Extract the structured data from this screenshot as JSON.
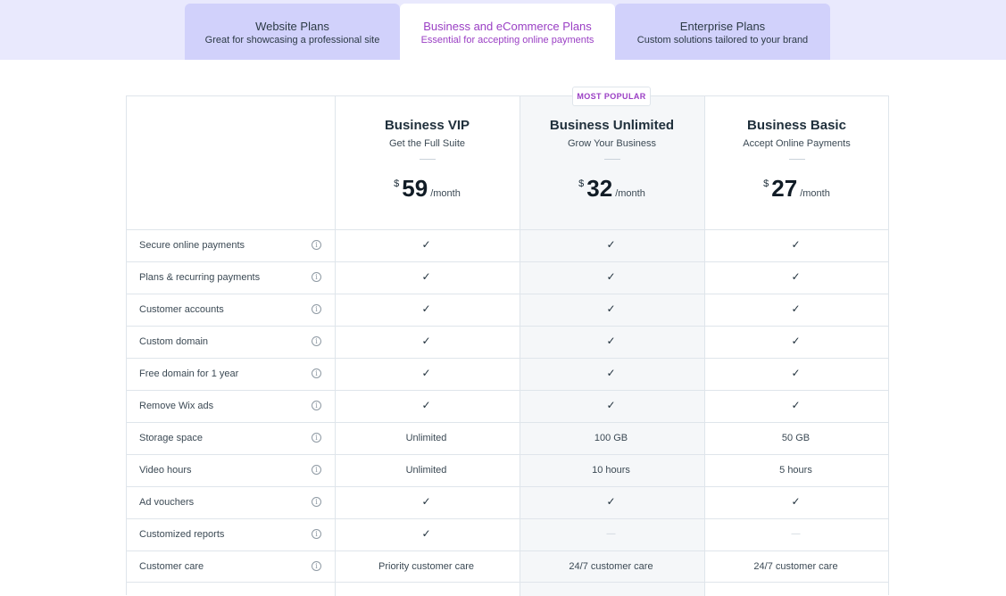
{
  "tabs": [
    {
      "title": "Website Plans",
      "subtitle": "Great for showcasing a professional site"
    },
    {
      "title": "Business and eCommerce Plans",
      "subtitle": "Essential for accepting online payments"
    },
    {
      "title": "Enterprise Plans",
      "subtitle": "Custom solutions tailored to your brand"
    }
  ],
  "badge": "MOST POPULAR",
  "plans": [
    {
      "name": "Business VIP",
      "tagline": "Get the Full Suite",
      "currency": "$",
      "price": "59",
      "period": "/month"
    },
    {
      "name": "Business Unlimited",
      "tagline": "Grow Your Business",
      "currency": "$",
      "price": "32",
      "period": "/month"
    },
    {
      "name": "Business Basic",
      "tagline": "Accept Online Payments",
      "currency": "$",
      "price": "27",
      "period": "/month"
    }
  ],
  "info_glyph": "i",
  "features": [
    {
      "label": "Secure online payments",
      "values": [
        "✓",
        "✓",
        "✓"
      ]
    },
    {
      "label": "Plans & recurring payments",
      "values": [
        "✓",
        "✓",
        "✓"
      ]
    },
    {
      "label": "Customer accounts",
      "values": [
        "✓",
        "✓",
        "✓"
      ]
    },
    {
      "label": "Custom domain",
      "values": [
        "✓",
        "✓",
        "✓"
      ]
    },
    {
      "label": "Free domain for 1 year",
      "values": [
        "✓",
        "✓",
        "✓"
      ]
    },
    {
      "label": "Remove Wix ads",
      "values": [
        "✓",
        "✓",
        "✓"
      ]
    },
    {
      "label": "Storage space",
      "values": [
        "Unlimited",
        "100 GB",
        "50 GB"
      ]
    },
    {
      "label": "Video hours",
      "values": [
        "Unlimited",
        "10 hours",
        "5 hours"
      ]
    },
    {
      "label": "Ad vouchers",
      "values": [
        "✓",
        "✓",
        "✓"
      ]
    },
    {
      "label": "Customized reports",
      "values": [
        "✓",
        "—",
        "—"
      ]
    },
    {
      "label": "Customer care",
      "values": [
        "Priority customer care",
        "24/7 customer care",
        "24/7 customer care"
      ]
    }
  ],
  "colors": {
    "accent": "#9a3fc4",
    "tab_strip": "#e9e9fd",
    "tab_inactive": "#d1d1fb",
    "highlight_column": "#f5f7f9"
  }
}
